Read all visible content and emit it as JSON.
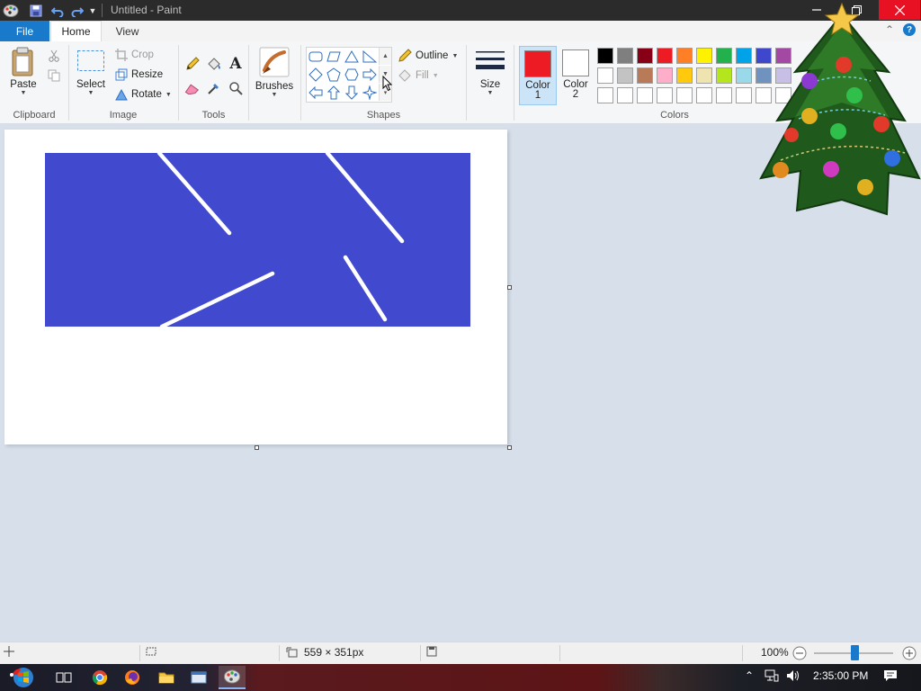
{
  "window": {
    "title": "Untitled - Paint"
  },
  "tabs": [
    {
      "label": "File"
    },
    {
      "label": "Home"
    },
    {
      "label": "View"
    }
  ],
  "help_icon_label": "?",
  "ribbon": {
    "clipboard": {
      "paste_label": "Paste",
      "group_label": "Clipboard"
    },
    "image": {
      "select_label": "Select",
      "crop_label": "Crop",
      "resize_label": "Resize",
      "rotate_label": "Rotate",
      "group_label": "Image"
    },
    "tools": {
      "group_label": "Tools",
      "items": [
        "pencil-icon",
        "fill-icon",
        "text-icon",
        "eraser-icon",
        "color-picker-icon",
        "magnifier-icon"
      ]
    },
    "brushes": {
      "label": "Brushes"
    },
    "shapes": {
      "group_label": "Shapes",
      "outline_label": "Outline",
      "fill_label": "Fill"
    },
    "size": {
      "label": "Size"
    },
    "colors": {
      "color1_label": "Color",
      "color1_num": "1",
      "color1_value": "#ed1c24",
      "color2_label": "Color",
      "color2_num": "2",
      "color2_value": "#ffffff",
      "group_label": "Colors",
      "palette": [
        "#000000",
        "#7f7f7f",
        "#880015",
        "#ed1c24",
        "#ff7f27",
        "#fff200",
        "#22b14c",
        "#00a2e8",
        "#3f48cc",
        "#a349a4",
        "#ffffff",
        "#c3c3c3",
        "#b97a57",
        "#ffaec9",
        "#ffc90e",
        "#efe4b0",
        "#b5e61d",
        "#99d9ea",
        "#7092be",
        "#c8bfe7",
        "#ffffff",
        "#ffffff",
        "#ffffff",
        "#ffffff",
        "#ffffff",
        "#ffffff",
        "#ffffff",
        "#ffffff",
        "#ffffff",
        "#ffffff"
      ]
    }
  },
  "canvas": {
    "image_color": "#4149cf",
    "line_color": "#ffffff"
  },
  "statusbar": {
    "dimensions": "559 × 351px",
    "zoom": "100%"
  },
  "taskbar": {
    "apps": [
      "windows-start-icon",
      "task-view-icon",
      "chrome-icon",
      "firefox-icon",
      "file-explorer-icon",
      "window-icon",
      "paint-icon"
    ],
    "time": "2:35:00 PM"
  }
}
